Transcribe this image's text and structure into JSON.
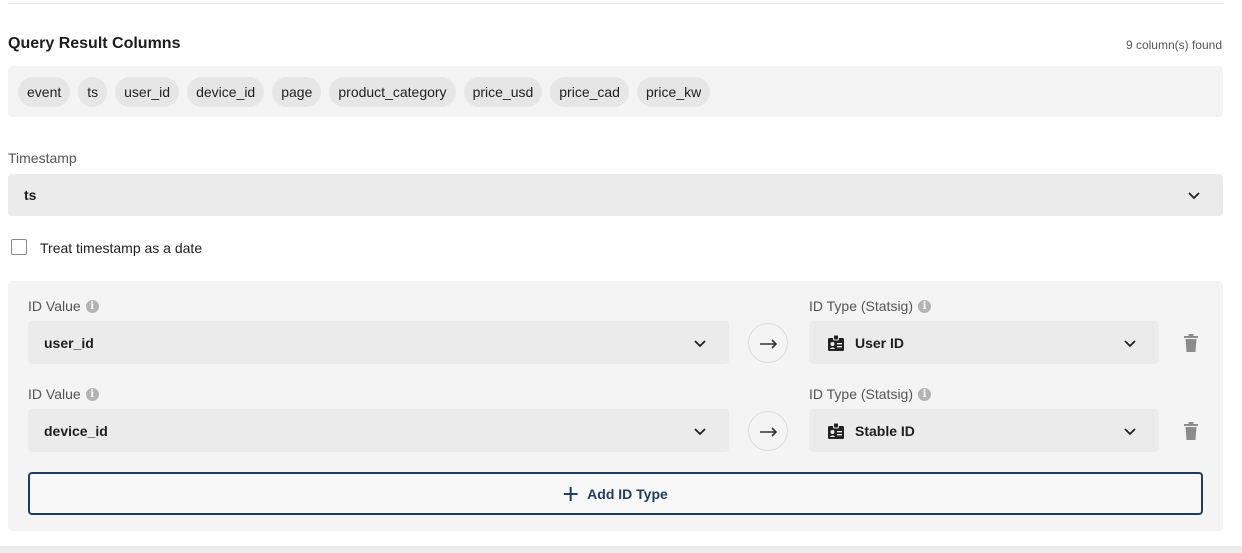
{
  "query_result": {
    "title": "Query Result Columns",
    "count_text": "9 column(s) found",
    "columns": [
      "event",
      "ts",
      "user_id",
      "device_id",
      "page",
      "product_category",
      "price_usd",
      "price_cad",
      "price_kw"
    ]
  },
  "timestamp": {
    "label": "Timestamp",
    "value": "ts"
  },
  "treat_as_date": {
    "label": "Treat timestamp as a date",
    "checked": false
  },
  "id_mappings": [
    {
      "value_label": "ID Value",
      "value": "user_id",
      "type_label": "ID Type (Statsig)",
      "type": "User ID"
    },
    {
      "value_label": "ID Value",
      "value": "device_id",
      "type_label": "ID Type (Statsig)",
      "type": "Stable ID"
    }
  ],
  "add_button_label": "Add ID Type",
  "colors": {
    "accent": "#1f3d63",
    "panel": "#f4f4f4",
    "select": "#ebebeb"
  }
}
